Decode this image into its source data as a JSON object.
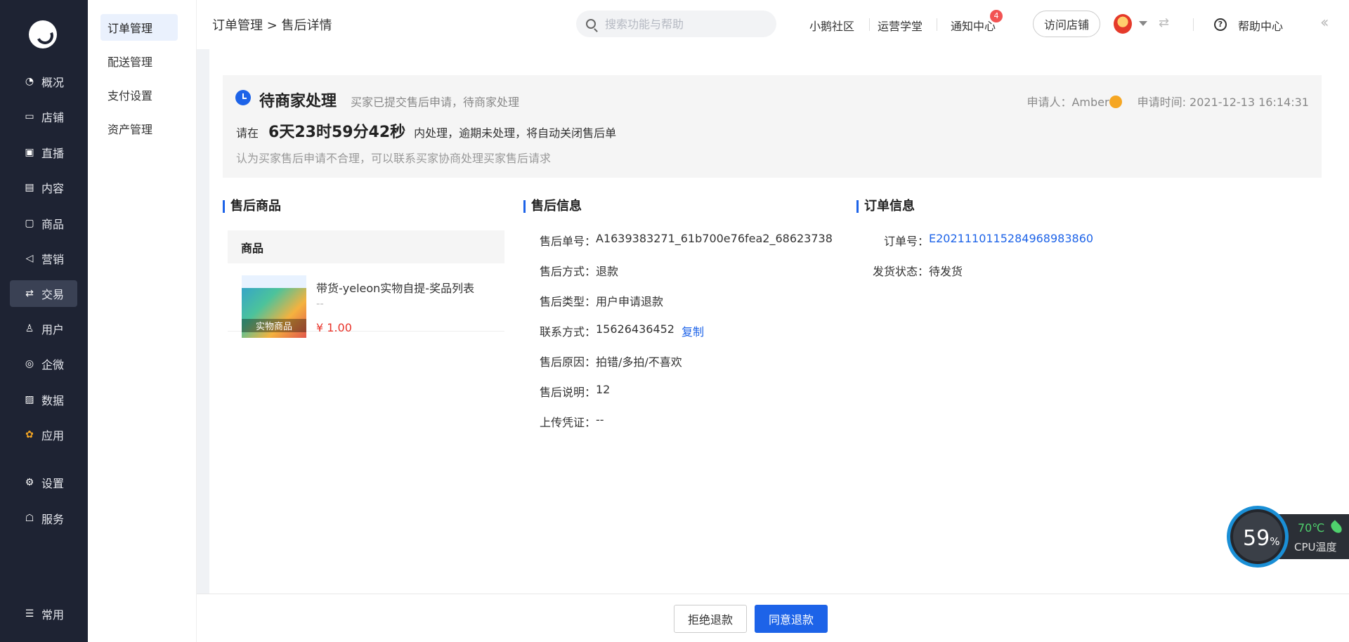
{
  "nav": {
    "items": [
      {
        "label": "概况",
        "icon": "chart-pie-icon"
      },
      {
        "label": "店铺",
        "icon": "store-icon"
      },
      {
        "label": "直播",
        "icon": "live-icon"
      },
      {
        "label": "内容",
        "icon": "document-icon"
      },
      {
        "label": "商品",
        "icon": "box-icon"
      },
      {
        "label": "营销",
        "icon": "megaphone-icon"
      },
      {
        "label": "交易",
        "icon": "exchange-icon"
      },
      {
        "label": "用户",
        "icon": "user-icon"
      },
      {
        "label": "企微",
        "icon": "wecom-icon"
      },
      {
        "label": "数据",
        "icon": "image-chart-icon"
      },
      {
        "label": "应用",
        "icon": "apps-icon"
      },
      {
        "label": "设置",
        "icon": "gear-icon"
      },
      {
        "label": "服务",
        "icon": "service-icon"
      },
      {
        "label": "常用",
        "icon": "list-icon"
      }
    ],
    "active": "交易"
  },
  "subnav": {
    "items": [
      "订单管理",
      "配送管理",
      "支付设置",
      "资产管理"
    ],
    "active": "订单管理"
  },
  "header": {
    "breadcrumb": "订单管理 > 售后详情",
    "search_placeholder": "搜索功能与帮助",
    "links": [
      "小鹅社区",
      "运营学堂",
      "通知中心"
    ],
    "notify_count": "4",
    "visit_label": "访问店铺",
    "help_label": "帮助中心"
  },
  "status": {
    "title": "待商家处理",
    "desc": "买家已提交售后申请，待商家处理",
    "applicant": "申请人：Amber",
    "apply_time": "申请时间: 2021-12-13 16:14:31",
    "prefix": "请在",
    "countdown": "6天23时59分42秒",
    "suffix": "内处理，逾期未处理，将自动关闭售后单",
    "hint": "认为买家售后申请不合理，可以联系买家协商处理买家售后请求"
  },
  "goods": {
    "section_title": "售后商品",
    "table_header": "商品",
    "name": "带货-yeleon实物自提-奖品列表",
    "spec": "--",
    "price": "¥ 1.00",
    "tag": "实物商品"
  },
  "aftersale": {
    "section_title": "售后信息",
    "fields": [
      {
        "k": "售后单号：",
        "v": "A1639383271_61b700e76fea2_68623738"
      },
      {
        "k": "售后方式：",
        "v": "退款"
      },
      {
        "k": "售后类型：",
        "v": "用户申请退款"
      },
      {
        "k": "联系方式：",
        "v": "15626436452"
      },
      {
        "k": "售后原因：",
        "v": "拍错/多拍/不喜欢"
      },
      {
        "k": "售后说明：",
        "v": "12"
      },
      {
        "k": "上传凭证：",
        "v": "--"
      }
    ],
    "copy_label": "复制"
  },
  "order": {
    "section_title": "订单信息",
    "fields": [
      {
        "k": "订单号：",
        "v": "E20211101152849689838​60"
      },
      {
        "k": "发货状态：",
        "v": "待发货"
      }
    ]
  },
  "footer": {
    "reject_label": "拒绝退款",
    "agree_label": "同意退款"
  },
  "cpu_widget": {
    "percent": "59",
    "percent_unit": "%",
    "temp": "70℃",
    "label": "CPU温度"
  },
  "colors": {
    "nav_bg": "#1e2333",
    "primary": "#1d63e8",
    "price": "#e8332a"
  }
}
